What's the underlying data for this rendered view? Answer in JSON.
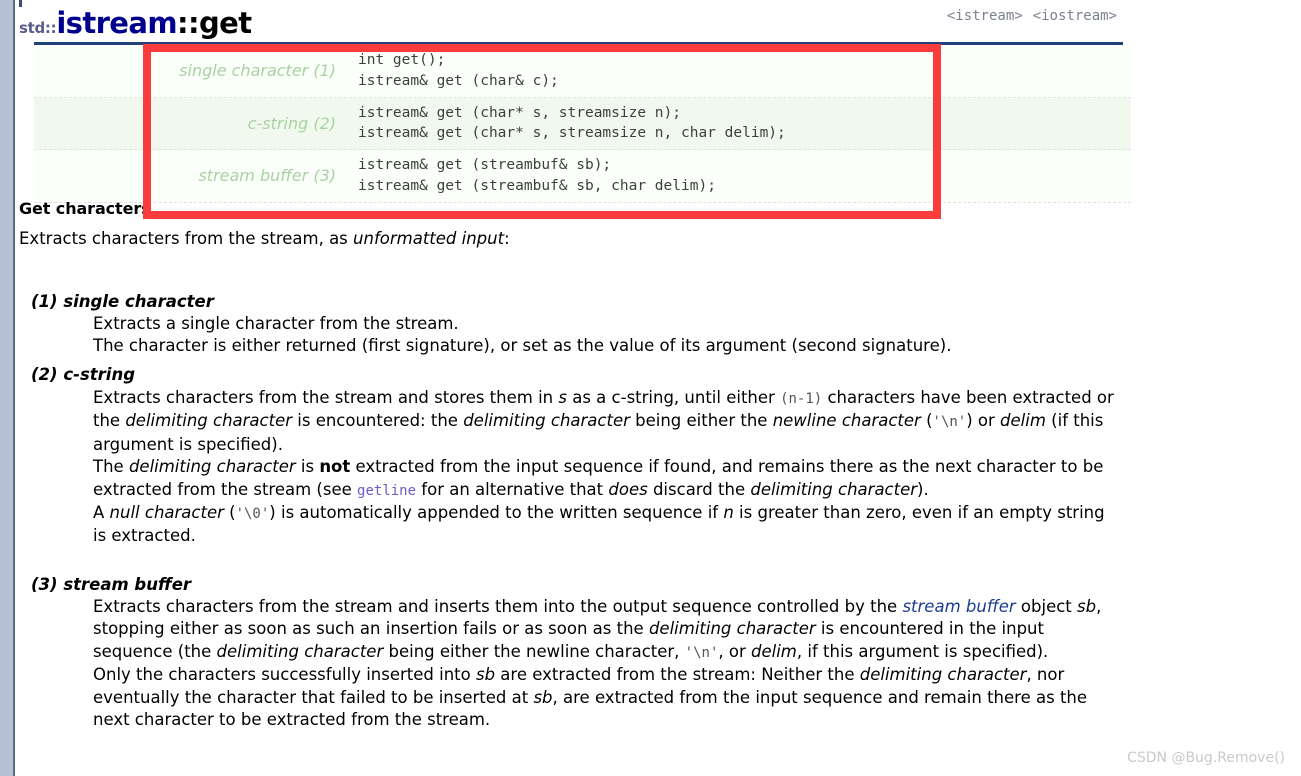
{
  "title": {
    "namespace": "std::",
    "name_primary": "istream",
    "name_separator": "::",
    "name_secondary": "get"
  },
  "headers": [
    {
      "label": "<istream>"
    },
    {
      "label": "<iostream>"
    }
  ],
  "signature_table": {
    "rows": [
      {
        "label": "single character (1)",
        "code": "int get();\nistream& get (char& c);"
      },
      {
        "label": "c-string (2)",
        "code": "istream& get (char* s, streamsize n);\nistream& get (char* s, streamsize n, char delim);"
      },
      {
        "label": "stream buffer (3)",
        "code": "istream& get (streambuf& sb);\nistream& get (streambuf& sb, char delim);"
      }
    ]
  },
  "section_heading": "Get characters",
  "intro": {
    "text_before": "Extracts characters from the stream, as ",
    "emphasis": "unformatted input",
    "text_after": ":"
  },
  "sections": [
    {
      "number": "(1)",
      "name": "single character",
      "lines": [
        "Extracts a single character from the stream.",
        "The character is either returned (first signature), or set as the value of its argument (second signature)."
      ]
    },
    {
      "number": "(2)",
      "name": "c-string",
      "lines": [
        "Extracts characters from the stream and stores them in s as a c-string, until either (n-1) characters have been extracted or the delimiting character is encountered: the delimiting character being either the newline character ('\\n') or delim (if this argument is specified).",
        "The delimiting character is not extracted from the input sequence if found, and remains there as the next character to be extracted from the stream (see getline for an alternative that does discard the delimiting character).",
        "A null character ('\\0') is automatically appended to the written sequence if n is greater than zero, even if an empty string is extracted."
      ]
    },
    {
      "number": "(3)",
      "name": "stream buffer",
      "lines": [
        "Extracts characters from the stream and inserts them into the output sequence controlled by the stream buffer object sb, stopping either as soon as such an insertion fails or as soon as the delimiting character is encountered in the input sequence (the delimiting character being either the newline character, '\\n', or delim, if this argument is specified).",
        "Only the characters successfully inserted into sb are extracted from the stream: Neither the delimiting character, nor eventually the character that failed to be inserted at sb, are extracted from the input sequence and remain there as the next character to be extracted from the stream."
      ]
    }
  ],
  "inline_terms": {
    "s": "s",
    "n": "n",
    "sb": "sb",
    "delim": "delim",
    "n_minus_1": "(n-1)",
    "newline_literal": "'\\n'",
    "null_literal": "'\\0'",
    "getline_link": "getline",
    "stream_buffer_link": "stream buffer",
    "delimiting_character": "delimiting character",
    "newline_character": "newline character",
    "null_character": "null character",
    "not_word": "not",
    "does_word": "does"
  },
  "watermark": "CSDN @Bug.Remove()",
  "colors": {
    "title_name": "#00008f",
    "title_namespace": "#5b5f8a",
    "rule": "#22407a",
    "annotation_box": "#fa3c3c",
    "row_label": "#a9d2a3",
    "row_odd_bg": "#fbfff9",
    "row_even_bg": "#f1f9ee",
    "link": "#1b3c8f",
    "code_link": "#6a5acd",
    "watermark": "#c9c9c9"
  }
}
